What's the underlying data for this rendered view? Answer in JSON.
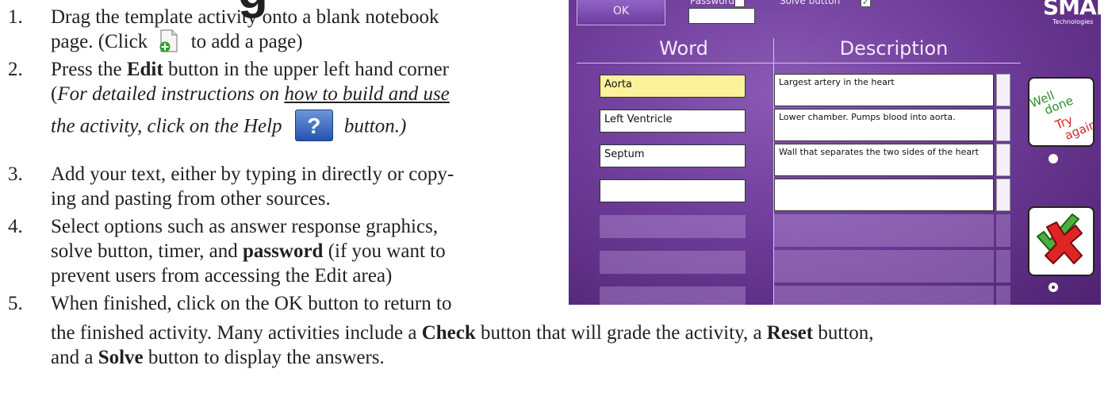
{
  "heading_fragment": "g",
  "instructions": [
    {
      "num": "1.",
      "line1_a": "Drag the template activity onto a blank notebook",
      "line2_a": "page. (Click",
      "line2_b": "to add a page)",
      "icon": "add-page-icon"
    },
    {
      "num": "2.",
      "line1_a": "Press the",
      "line1_bold": "Edit",
      "line1_b": "button in the upper left hand corner",
      "line2_a": "(",
      "line2_italic": "For detailed instructions on ",
      "line2_underline": "how to build and use",
      "line3_italic": "the activity, click on the Help",
      "line3_b": "button.)",
      "icon": "help-icon",
      "icon_glyph": "?"
    },
    {
      "num": "3.",
      "line1_a": "Add your text, either by typing in directly or copy-",
      "line2_a": "ing and pasting from other sources."
    },
    {
      "num": "4.",
      "line1_a": "Select options such as answer response graphics,",
      "line2_a": "solve button, timer, and",
      "line2_bold": "password",
      "line2_b": "(if you want to",
      "line3_a": "prevent users from accessing the Edit area)"
    },
    {
      "num": "5.",
      "line1_a": "When finished, click on the OK button to return to",
      "line2_a": "the finished activity. Many activities include a",
      "line2_bold1": "Check",
      "line2_b": "button that will grade the activity, a",
      "line2_bold2": "Reset",
      "line2_c": "button,",
      "line3_a": "and a",
      "line3_bold": "Solve",
      "line3_b": "button to display the answers."
    }
  ],
  "activity": {
    "ok_label": "OK",
    "password_label": "Password",
    "solve_button_label": "Solve button",
    "solve_checked_glyph": "✓",
    "logo": "SMART",
    "logo_sub": "Technologies",
    "col_word": "Word",
    "col_description": "Description",
    "rows": [
      {
        "word": "Aorta",
        "description": "Largest artery in the heart"
      },
      {
        "word": "Left Ventricle",
        "description": "Lower chamber. Pumps blood into aorta."
      },
      {
        "word": "Septum",
        "description": "Wall that separates the two sides of the heart"
      },
      {
        "word": "",
        "description": ""
      }
    ],
    "response_text": {
      "well": "Well",
      "done": "done",
      "try": "Try",
      "again": "again"
    },
    "colors": {
      "bg_center": "#8a5ab4",
      "bg_edge": "#4e2270",
      "active_field": "#fbf39b"
    }
  }
}
